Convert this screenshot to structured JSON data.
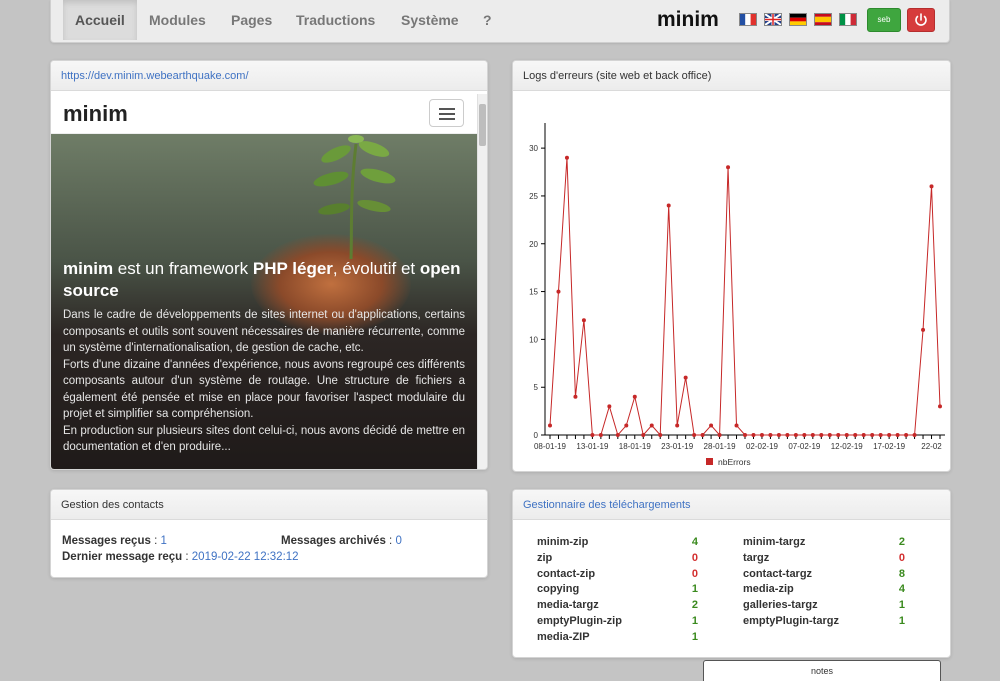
{
  "nav": {
    "items": [
      "Accueil",
      "Modules",
      "Pages",
      "Traductions",
      "Système",
      "?"
    ],
    "brand": "minim",
    "languages": [
      "fr",
      "en",
      "de",
      "es",
      "it"
    ],
    "user_button": "seb",
    "logout_icon": "power-icon",
    "user_color": "#3fa63f",
    "logout_color": "#d63c3c"
  },
  "site_preview": {
    "url": "https://dev.minim.webearthquake.com/",
    "brand": "minim",
    "title_parts": [
      "minim",
      " est un framework ",
      "PHP léger",
      ", évolutif et ",
      "open source"
    ],
    "paragraphs": [
      "Dans le cadre de développements de sites internet ou d'applications, certains composants et outils sont souvent nécessaires de manière récurrente, comme un système d'internationalisation, de gestion de cache, etc.",
      "Forts d'une dizaine d'années d'expérience, nous avons regroupé ces différents composants autour d'un système de routage. Une structure de fichiers a également été pensée et mise en place pour favoriser l'aspect modulaire du projet et simplifier sa compréhension.",
      "En production sur plusieurs sites dont celui-ci, nous avons décidé de mettre en documentation et d'en produire..."
    ]
  },
  "errors": {
    "title": "Logs d'erreurs (site web et back office)"
  },
  "chart_data": {
    "type": "line",
    "title": "",
    "xlabel": "",
    "ylabel": "",
    "ylim": [
      0,
      32
    ],
    "yticks": [
      0,
      5,
      10,
      15,
      20,
      25,
      30
    ],
    "xtick_labels": [
      "08-01-19",
      "13-01-19",
      "18-01-19",
      "23-01-19",
      "28-01-19",
      "02-02-19",
      "07-02-19",
      "12-02-19",
      "17-02-19",
      "22-02"
    ],
    "xtick_index": [
      0,
      5,
      10,
      15,
      20,
      25,
      30,
      35,
      40,
      45
    ],
    "series": [
      {
        "name": "nbErrors",
        "color": "#c62828",
        "values": [
          1,
          15,
          29,
          4,
          12,
          0,
          0,
          3,
          0,
          1,
          4,
          0,
          1,
          0,
          24,
          1,
          6,
          0,
          0,
          1,
          0,
          28,
          1,
          0,
          0,
          0,
          0,
          0,
          0,
          0,
          0,
          0,
          0,
          0,
          0,
          0,
          0,
          0,
          0,
          0,
          0,
          0,
          0,
          0,
          11,
          26,
          3
        ]
      }
    ],
    "grid": false,
    "legend": "bottom"
  },
  "contacts": {
    "title": "Gestion des contacts",
    "received_label": "Messages reçus",
    "received_value": "1",
    "archived_label": "Messages archivés",
    "archived_value": "0",
    "last_label": "Dernier message reçu",
    "last_value": "2019-02-22 12:32:12"
  },
  "downloads": {
    "title": "Gestionnaire des téléchargements",
    "left": [
      {
        "name": "minim-zip",
        "count": "4",
        "color": "#3a8a1e"
      },
      {
        "name": "zip",
        "count": "0",
        "color": "#d32f2f"
      },
      {
        "name": "contact-zip",
        "count": "0",
        "color": "#d32f2f"
      },
      {
        "name": "copying",
        "count": "1",
        "color": "#3a8a1e"
      },
      {
        "name": "media-targz",
        "count": "2",
        "color": "#3a8a1e"
      },
      {
        "name": "emptyPlugin-zip",
        "count": "1",
        "color": "#3a8a1e"
      },
      {
        "name": "media-ZIP",
        "count": "1",
        "color": "#3a8a1e"
      }
    ],
    "right": [
      {
        "name": "minim-targz",
        "count": "2",
        "color": "#3a8a1e"
      },
      {
        "name": "targz",
        "count": "0",
        "color": "#d32f2f"
      },
      {
        "name": "contact-targz",
        "count": "8",
        "color": "#3a8a1e"
      },
      {
        "name": "media-zip",
        "count": "4",
        "color": "#3a8a1e"
      },
      {
        "name": "galleries-targz",
        "count": "1",
        "color": "#3a8a1e"
      },
      {
        "name": "emptyPlugin-targz",
        "count": "1",
        "color": "#3a8a1e"
      }
    ]
  },
  "notes": {
    "label": "notes"
  }
}
